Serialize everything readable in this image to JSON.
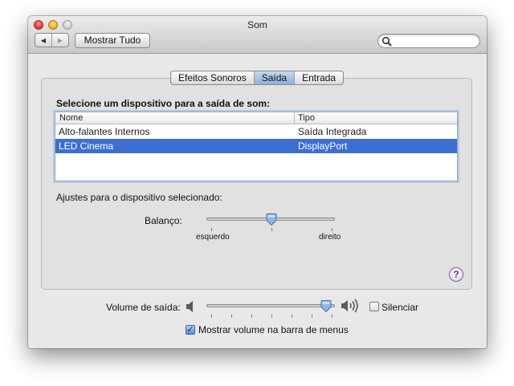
{
  "window": {
    "title": "Som"
  },
  "toolbar": {
    "back_icon": "◀",
    "forward_icon": "▶",
    "show_all_label": "Mostrar Tudo",
    "search_value": ""
  },
  "tabs": [
    {
      "label": "Efeitos Sonoros",
      "selected": false
    },
    {
      "label": "Saída",
      "selected": true
    },
    {
      "label": "Entrada",
      "selected": false
    }
  ],
  "output": {
    "heading": "Selecione um dispositivo para a saída de som:",
    "columns": [
      "Nome",
      "Tipo"
    ],
    "devices": [
      {
        "name": "Alto-falantes Internos",
        "type": "Saída Integrada",
        "selected": false
      },
      {
        "name": "LED Cinema",
        "type": "DisplayPort",
        "selected": true
      }
    ]
  },
  "settings": {
    "heading": "Ajustes para o dispositivo selecionado:",
    "balance_label": "Balanço:",
    "balance_left": "esquerdo",
    "balance_right": "direito",
    "balance_value": 0.5
  },
  "help": {
    "glyph": "?"
  },
  "volume": {
    "label": "Volume de saída:",
    "value": 0.95,
    "mute_label": "Silenciar",
    "mute_checked": false,
    "show_in_menubar_label": "Mostrar volume na barra de menus",
    "show_in_menubar_checked": true
  },
  "colors": {
    "selection": "#3c6fd0",
    "tab_active": "#8cb1dc",
    "help": "#5e2f9e"
  }
}
